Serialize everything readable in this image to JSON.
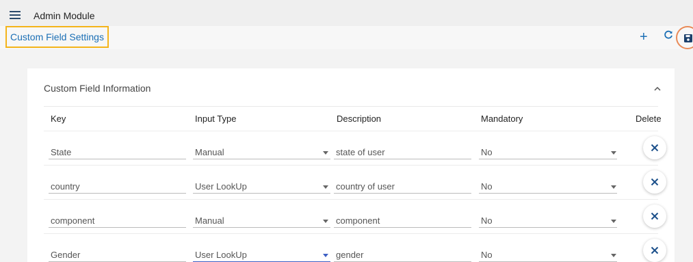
{
  "app": {
    "title": "Admin Module"
  },
  "page": {
    "title": "Custom Field Settings"
  },
  "toolbar": {
    "add_icon": "plus-icon",
    "refresh_icon": "refresh-icon",
    "save_icon": "save-icon"
  },
  "card": {
    "title": "Custom Field Information",
    "collapse_icon": "chevron-up-icon"
  },
  "table": {
    "headers": [
      "Key",
      "Input Type",
      "Description",
      "Mandatory",
      "Delete"
    ],
    "rows": [
      {
        "key": "State",
        "input_type": "Manual",
        "description": "state of user",
        "mandatory": "No"
      },
      {
        "key": "country",
        "input_type": "User LookUp",
        "description": "country of user",
        "mandatory": "No"
      },
      {
        "key": "component",
        "input_type": "Manual",
        "description": "component",
        "mandatory": "No"
      },
      {
        "key": "Gender",
        "input_type": "User LookUp",
        "description": "gender",
        "mandatory": "No"
      }
    ]
  },
  "colors": {
    "accent": "#1b6fb5",
    "highlight": "#f4b41a",
    "save_ring": "#e98a57",
    "active_field": "#3d5fc4"
  }
}
